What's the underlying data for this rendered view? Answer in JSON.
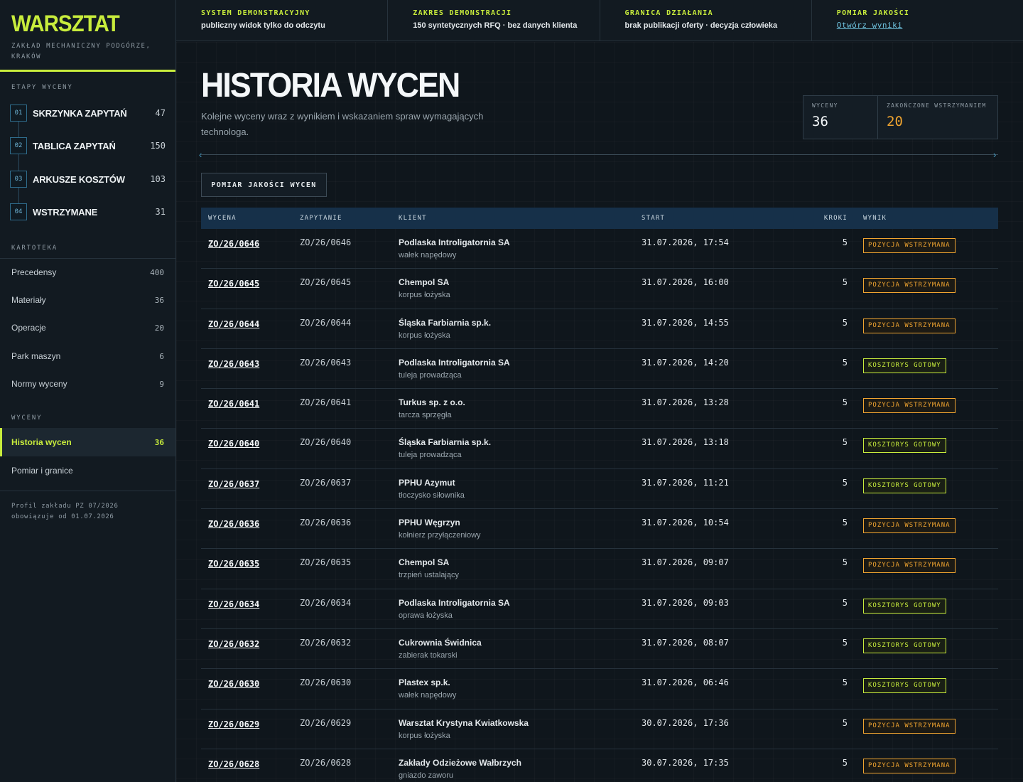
{
  "brand": {
    "title": "WARSZTAT",
    "subtitle": "ZAKŁAD MECHANICZNY PODGÓRZE, KRAKÓW"
  },
  "sidebar": {
    "stages_label": "ETAPY WYCENY",
    "stages": [
      {
        "num": "01",
        "label": "SKRZYNKA ZAPYTAŃ",
        "count": "47"
      },
      {
        "num": "02",
        "label": "TABLICA ZAPYTAŃ",
        "count": "150"
      },
      {
        "num": "03",
        "label": "ARKUSZE KOSZTÓW",
        "count": "103"
      },
      {
        "num": "04",
        "label": "WSTRZYMANE",
        "count": "31"
      }
    ],
    "kartoteka_label": "KARTOTEKA",
    "kartoteka": [
      {
        "label": "Precedensy",
        "count": "400"
      },
      {
        "label": "Materiały",
        "count": "36"
      },
      {
        "label": "Operacje",
        "count": "20"
      },
      {
        "label": "Park maszyn",
        "count": "6"
      },
      {
        "label": "Normy wyceny",
        "count": "9"
      }
    ],
    "wyceny_label": "WYCENY",
    "wyceny": [
      {
        "label": "Historia wycen",
        "count": "36"
      },
      {
        "label": "Pomiar i granice",
        "count": ""
      }
    ],
    "profile_line1": "Profil zakładu PZ 07/2026",
    "profile_line2": "obowiązuje od 01.07.2026"
  },
  "topbar": [
    {
      "label": "SYSTEM DEMONSTRACYJNY",
      "value": "publiczny widok tylko do odczytu"
    },
    {
      "label": "ZAKRES DEMONSTRACJI",
      "value": "150 syntetycznych RFQ · bez danych klienta"
    },
    {
      "label": "GRANICA DZIAŁANIA",
      "value": "brak publikacji oferty · decyzja człowieka"
    },
    {
      "label": "POMIAR JAKOŚCI",
      "link": "Otwórz wyniki"
    }
  ],
  "page": {
    "title": "HISTORIA WYCEN",
    "subtitle": "Kolejne wyceny wraz z wynikiem i wskazaniem spraw wymagających technologa.",
    "stats": [
      {
        "label": "WYCENY",
        "value": "36"
      },
      {
        "label": "ZAKOŃCZONE WSTRZYMANIEM",
        "value": "20"
      }
    ],
    "quality_button": "POMIAR JAKOŚCI WYCEN"
  },
  "table": {
    "headers": [
      "WYCENA",
      "ZAPYTANIE",
      "KLIENT",
      "START",
      "KROKI",
      "WYNIK"
    ],
    "rows": [
      {
        "id": "ZO/26/0646",
        "req": "ZO/26/0646",
        "client": "Podlaska Introligatornia SA",
        "part": "wałek napędowy",
        "start": "31.07.2026, 17:54",
        "steps": "5",
        "result": "POZYCJA WSTRZYMANA",
        "status": "hold"
      },
      {
        "id": "ZO/26/0645",
        "req": "ZO/26/0645",
        "client": "Chempol SA",
        "part": "korpus łożyska",
        "start": "31.07.2026, 16:00",
        "steps": "5",
        "result": "POZYCJA WSTRZYMANA",
        "status": "hold"
      },
      {
        "id": "ZO/26/0644",
        "req": "ZO/26/0644",
        "client": "Śląska Farbiarnia sp.k.",
        "part": "korpus łożyska",
        "start": "31.07.2026, 14:55",
        "steps": "5",
        "result": "POZYCJA WSTRZYMANA",
        "status": "hold"
      },
      {
        "id": "ZO/26/0643",
        "req": "ZO/26/0643",
        "client": "Podlaska Introligatornia SA",
        "part": "tuleja prowadząca",
        "start": "31.07.2026, 14:20",
        "steps": "5",
        "result": "KOSZTORYS GOTOWY",
        "status": "ready"
      },
      {
        "id": "ZO/26/0641",
        "req": "ZO/26/0641",
        "client": "Turkus sp. z o.o.",
        "part": "tarcza sprzęgła",
        "start": "31.07.2026, 13:28",
        "steps": "5",
        "result": "POZYCJA WSTRZYMANA",
        "status": "hold"
      },
      {
        "id": "ZO/26/0640",
        "req": "ZO/26/0640",
        "client": "Śląska Farbiarnia sp.k.",
        "part": "tuleja prowadząca",
        "start": "31.07.2026, 13:18",
        "steps": "5",
        "result": "KOSZTORYS GOTOWY",
        "status": "ready"
      },
      {
        "id": "ZO/26/0637",
        "req": "ZO/26/0637",
        "client": "PPHU Azymut",
        "part": "tłoczysko siłownika",
        "start": "31.07.2026, 11:21",
        "steps": "5",
        "result": "KOSZTORYS GOTOWY",
        "status": "ready"
      },
      {
        "id": "ZO/26/0636",
        "req": "ZO/26/0636",
        "client": "PPHU Węgrzyn",
        "part": "kołnierz przyłączeniowy",
        "start": "31.07.2026, 10:54",
        "steps": "5",
        "result": "POZYCJA WSTRZYMANA",
        "status": "hold"
      },
      {
        "id": "ZO/26/0635",
        "req": "ZO/26/0635",
        "client": "Chempol SA",
        "part": "trzpień ustalający",
        "start": "31.07.2026, 09:07",
        "steps": "5",
        "result": "POZYCJA WSTRZYMANA",
        "status": "hold"
      },
      {
        "id": "ZO/26/0634",
        "req": "ZO/26/0634",
        "client": "Podlaska Introligatornia SA",
        "part": "oprawa łożyska",
        "start": "31.07.2026, 09:03",
        "steps": "5",
        "result": "KOSZTORYS GOTOWY",
        "status": "ready"
      },
      {
        "id": "ZO/26/0632",
        "req": "ZO/26/0632",
        "client": "Cukrownia Świdnica",
        "part": "zabierak tokarski",
        "start": "31.07.2026, 08:07",
        "steps": "5",
        "result": "KOSZTORYS GOTOWY",
        "status": "ready"
      },
      {
        "id": "ZO/26/0630",
        "req": "ZO/26/0630",
        "client": "Plastex sp.k.",
        "part": "wałek napędowy",
        "start": "31.07.2026, 06:46",
        "steps": "5",
        "result": "KOSZTORYS GOTOWY",
        "status": "ready"
      },
      {
        "id": "ZO/26/0629",
        "req": "ZO/26/0629",
        "client": "Warsztat Krystyna Kwiatkowska",
        "part": "korpus łożyska",
        "start": "30.07.2026, 17:36",
        "steps": "5",
        "result": "POZYCJA WSTRZYMANA",
        "status": "hold"
      },
      {
        "id": "ZO/26/0628",
        "req": "ZO/26/0628",
        "client": "Zakłady Odzieżowe Wałbrzych",
        "part": "gniazdo zaworu",
        "start": "30.07.2026, 17:35",
        "steps": "5",
        "result": "POZYCJA WSTRZYMANA",
        "status": "hold"
      }
    ]
  },
  "colors": {
    "accent": "#c8ec3c",
    "hold": "#f0a430",
    "link": "#6fc4e0",
    "header_bg": "#163049"
  }
}
